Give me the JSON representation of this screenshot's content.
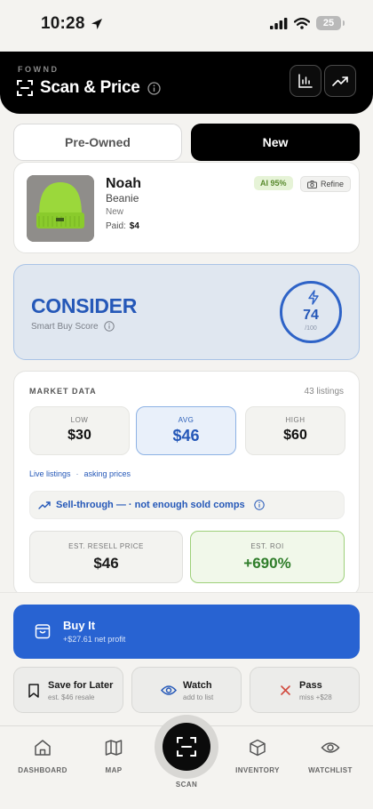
{
  "status_bar": {
    "time": "10:28",
    "battery": "25"
  },
  "header": {
    "brand": "FOWND",
    "title": "Scan & Price"
  },
  "tabs": [
    {
      "label": "Pre-Owned"
    },
    {
      "label": "New"
    }
  ],
  "item": {
    "name": "Noah",
    "type": "Beanie",
    "condition": "New",
    "paid_label": "Paid:",
    "paid_value": "$4",
    "ai_badge": "AI 95%",
    "refine_label": "Refine"
  },
  "verdict": {
    "title": "CONSIDER",
    "subtitle": "Smart Buy Score",
    "score": "74",
    "score_denominator": "/100",
    "accent": "#2558b8"
  },
  "market": {
    "title": "MARKET DATA",
    "listings": "43 listings",
    "stats": [
      {
        "label": "LOW",
        "value": "$30"
      },
      {
        "label": "AVG",
        "value": "$46"
      },
      {
        "label": "HIGH",
        "value": "$60"
      }
    ],
    "live_label": "Live listings",
    "live_sep": "·",
    "live_note": "asking prices",
    "sell_through": "Sell-through — · not enough sold comps",
    "resell": {
      "label": "EST. RESELL PRICE",
      "value": "$46"
    },
    "roi": {
      "label": "EST. ROI",
      "value": "+690%"
    }
  },
  "actions": {
    "buy": {
      "title": "Buy It",
      "subtitle": "+$27.61 net profit"
    },
    "save": {
      "title": "Save for Later",
      "subtitle": "est. $46 resale"
    },
    "watch": {
      "title": "Watch",
      "subtitle": "add to list"
    },
    "pass": {
      "title": "Pass",
      "subtitle": "miss +$28"
    }
  },
  "nav": {
    "dashboard": "DASHBOARD",
    "map": "MAP",
    "scan": "SCAN",
    "inventory": "INVENTORY",
    "watchlist": "WATCHLIST"
  },
  "colors": {
    "primary": "#2863d2",
    "roi_green": "#2f7d2a",
    "header_bg": "#000000"
  }
}
